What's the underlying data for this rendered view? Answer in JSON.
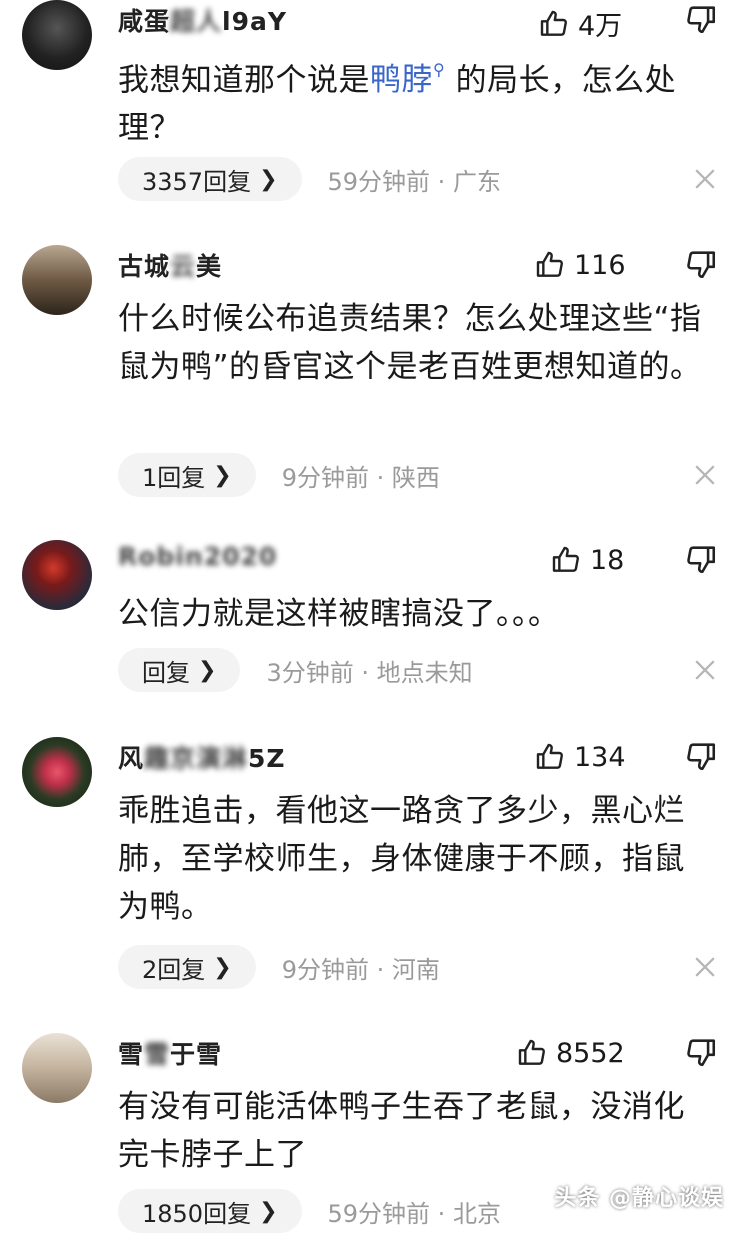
{
  "comments": [
    {
      "username_visible": "咸蛋",
      "username_blur": "超人",
      "username_tail": "l9aY",
      "likes": "4万",
      "text_a": "我想知道那个说是",
      "text_link": "鸭脖",
      "text_b": "的局长，怎么处理？",
      "reply_label": "3357回复",
      "time_location": "59分钟前 · 广东"
    },
    {
      "username_visible": "古城",
      "username_blur": "云",
      "username_tail": "美",
      "likes": "116",
      "text": "什么时候公布追责结果？怎么处理这些“指鼠为鸭”的昏官这个是老百姓更想知道的。",
      "reply_label": "1回复",
      "time_location": "9分钟前 · 陕西"
    },
    {
      "username_visible": "",
      "username_blur": "Robin",
      "username_tail": "2020",
      "likes": "18",
      "text": "公信力就是这样被瞎搞没了。。。",
      "reply_label": "回复",
      "time_location": "3分钟前 · 地点未知"
    },
    {
      "username_visible": "风",
      "username_blur": "趣京演淋",
      "username_tail": "5Z",
      "likes": "134",
      "text": "乖胜追击，看他这一路贪了多少，黑心烂肺，至学校师生，身体健康于不顾，指鼠为鸭。",
      "reply_label": "2回复",
      "time_location": "9分钟前 · 河南"
    },
    {
      "username_visible": "雪",
      "username_blur": "雪",
      "username_tail": "于雪",
      "likes": "8552",
      "text": "有没有可能活体鸭子生吞了老鼠，没消化完卡脖子上了",
      "reply_label": "1850回复",
      "time_location": "59分钟前 · 北京"
    }
  ],
  "watermark": "头条 @静心谈娱"
}
